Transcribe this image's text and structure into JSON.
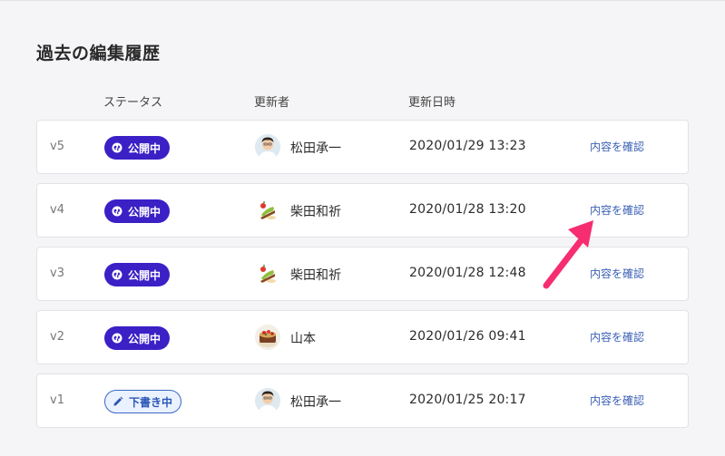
{
  "title": "過去の編集履歴",
  "columns": {
    "status": "ステータス",
    "author": "更新者",
    "datetime": "更新日時"
  },
  "rows": [
    {
      "version": "v5",
      "status": "公開中",
      "status_type": "published",
      "avatar_icon": "person-photo",
      "author": "松田承一",
      "datetime": "2020/01/29 13:23",
      "link": "内容を確認"
    },
    {
      "version": "v4",
      "status": "公開中",
      "status_type": "published",
      "avatar_icon": "dessert-photo",
      "author": "柴田和祈",
      "datetime": "2020/01/28 13:20",
      "link": "内容を確認"
    },
    {
      "version": "v3",
      "status": "公開中",
      "status_type": "published",
      "avatar_icon": "dessert-photo",
      "author": "柴田和祈",
      "datetime": "2020/01/28 12:48",
      "link": "内容を確認"
    },
    {
      "version": "v2",
      "status": "公開中",
      "status_type": "published",
      "avatar_icon": "cake-photo",
      "author": "山本",
      "datetime": "2020/01/26 09:41",
      "link": "内容を確認"
    },
    {
      "version": "v1",
      "status": "下書き中",
      "status_type": "draft",
      "avatar_icon": "person-photo",
      "author": "松田承一",
      "datetime": "2020/01/25 20:17",
      "link": "内容を確認"
    }
  ],
  "colors": {
    "published_badge": "#3b20c6",
    "draft_badge_bg": "#eaf2ff",
    "draft_badge_text": "#2c55b8",
    "link": "#3a5fb5",
    "annotation_arrow": "#f62d70",
    "background": "#f5f5f7"
  }
}
